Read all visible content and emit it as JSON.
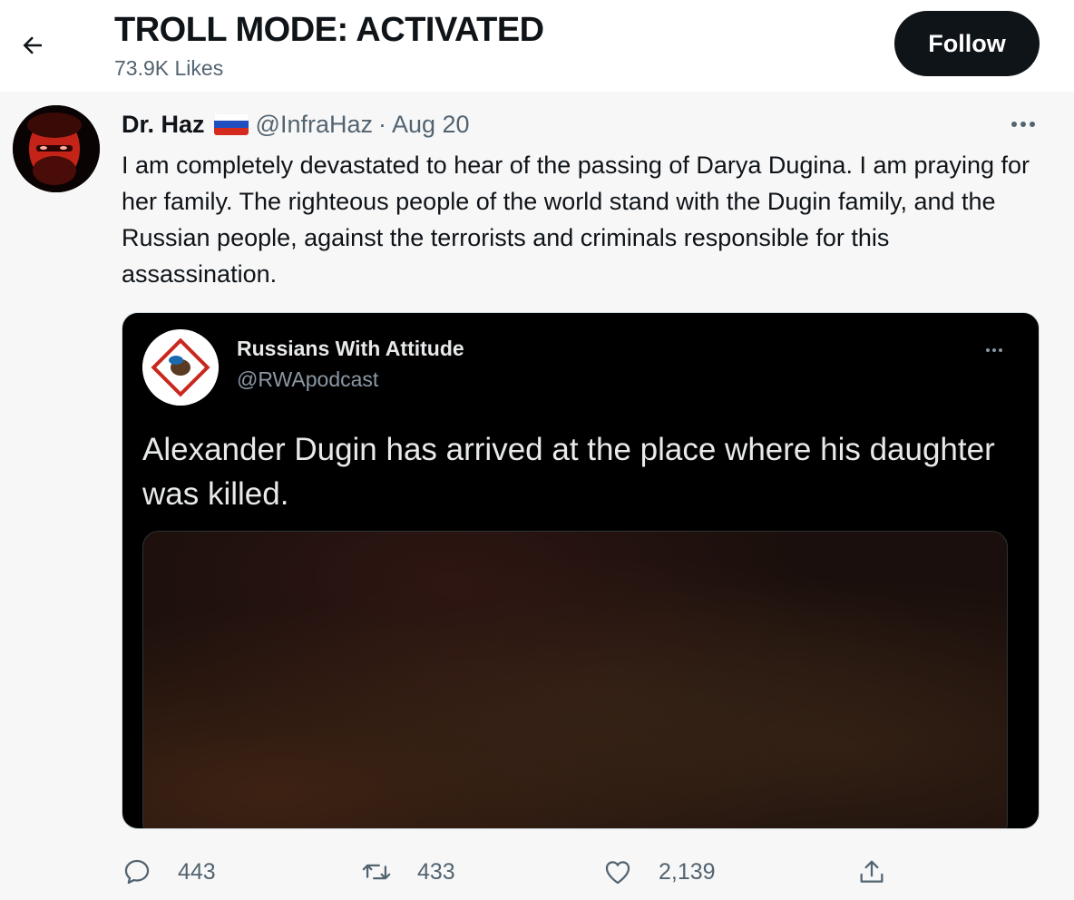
{
  "header": {
    "title": "TROLL MODE: ACTIVATED",
    "likes": "73.9K Likes",
    "follow_label": "Follow"
  },
  "tweet": {
    "author_name": "Dr. Haz",
    "handle": "@InfraHaz",
    "separator": "·",
    "date": "Aug 20",
    "text": "I am completely devastated to hear of the passing of Darya Dugina. I am praying for her family. The righteous people of the world stand with the Dugin family, and the Russian people, against the terrorists and criminals responsible for this assassination."
  },
  "quote": {
    "author_name": "Russians With Attitude",
    "handle": "@RWApodcast",
    "text": "Alexander Dugin has arrived at the place where his daughter was killed."
  },
  "actions": {
    "replies": "443",
    "retweets": "433",
    "likes": "2,139"
  },
  "icons": {
    "back": "back-arrow-icon",
    "more": "more-icon",
    "reply": "reply-icon",
    "retweet": "retweet-icon",
    "like": "heart-icon",
    "share": "share-icon",
    "flag": "russia-flag-icon"
  },
  "colors": {
    "text_primary": "#0f1419",
    "text_secondary": "#536471",
    "follow_bg": "#0f1419",
    "quote_bg": "#000000"
  }
}
